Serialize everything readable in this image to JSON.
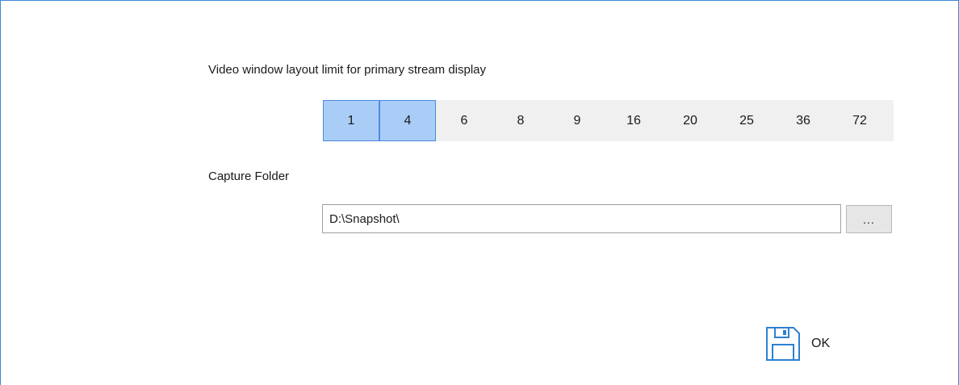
{
  "layout_section": {
    "label": "Video window layout limit for primary stream display",
    "options": [
      {
        "label": "1",
        "selected": true
      },
      {
        "label": "4",
        "selected": true
      },
      {
        "label": "6",
        "selected": false
      },
      {
        "label": "8",
        "selected": false
      },
      {
        "label": "9",
        "selected": false
      },
      {
        "label": "16",
        "selected": false
      },
      {
        "label": "20",
        "selected": false
      },
      {
        "label": "25",
        "selected": false
      },
      {
        "label": "36",
        "selected": false
      },
      {
        "label": "72",
        "selected": false
      }
    ]
  },
  "capture_section": {
    "label": "Capture Folder",
    "folder_value": "D:\\Snapshot\\",
    "browse_label": "..."
  },
  "footer": {
    "ok_label": "OK",
    "ok_icon": "save-icon"
  },
  "colors": {
    "frame_border": "#3c8ad6",
    "selected_fill": "#a9cdf7",
    "selected_border": "#4a8be0",
    "icon_stroke": "#2f7fd0"
  }
}
